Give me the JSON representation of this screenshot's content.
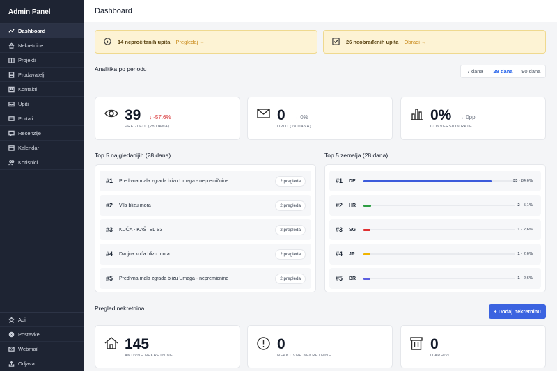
{
  "app": {
    "title": "Admin Panel"
  },
  "sidebar": {
    "items": [
      {
        "label": "Dashboard",
        "icon": "trend-icon",
        "active": true
      },
      {
        "label": "Nekretnine",
        "icon": "home-icon"
      },
      {
        "label": "Projekti",
        "icon": "building-icon"
      },
      {
        "label": "Prodavatelji",
        "icon": "users-icon"
      },
      {
        "label": "Kontakti",
        "icon": "contact-icon"
      },
      {
        "label": "Upiti",
        "icon": "inbox-icon"
      },
      {
        "label": "Portali",
        "icon": "globe-icon"
      },
      {
        "label": "Recenzije",
        "icon": "review-icon"
      },
      {
        "label": "Kalendar",
        "icon": "calendar-icon"
      },
      {
        "label": "Korisnici",
        "icon": "user-group-icon"
      }
    ],
    "bottom": [
      {
        "label": "Adi",
        "icon": "star-icon"
      },
      {
        "label": "Postavke",
        "icon": "gear-icon"
      },
      {
        "label": "Webmail",
        "icon": "mail-icon"
      },
      {
        "label": "Odjava",
        "icon": "logout-icon"
      }
    ]
  },
  "header": {
    "title": "Dashboard"
  },
  "alerts": {
    "unread": {
      "text": "14 nepročitanih upita",
      "action": "Pregledaj →"
    },
    "unprocessed": {
      "text": "26 neobrađenih upita",
      "action": "Obradi →"
    }
  },
  "analytics": {
    "title": "Analitika po periodu",
    "ranges": [
      "7 dana",
      "28 dana",
      "90 dana"
    ],
    "selected_range": "28 dana",
    "stats": [
      {
        "value": "39",
        "delta": "↓ -57.6%",
        "label": "PREGLEDI (28 DANA)",
        "icon": "eye-icon",
        "delta_color": "#d9383a"
      },
      {
        "value": "0",
        "delta": "→ 0%",
        "label": "UPITI (28 DANA)",
        "icon": "envelope-icon",
        "delta_color": "#6b7280"
      },
      {
        "value": "0%",
        "delta": "→ 0pp",
        "label": "CONVERSION RATE",
        "icon": "bar-chart-icon",
        "delta_color": "#6b7280"
      }
    ]
  },
  "top_viewed": {
    "title": "Top 5 najgledanijih (28 dana)",
    "rows": [
      {
        "rank": "#1",
        "name": "Predivna mala zgrada blizu Umaga - nepremičnine",
        "views": "2 pregleda"
      },
      {
        "rank": "#2",
        "name": "Vila blizu mora",
        "views": "2 pregleda"
      },
      {
        "rank": "#3",
        "name": "KUĆA - KAŠTEL S3",
        "views": "2 pregleda"
      },
      {
        "rank": "#4",
        "name": "Dvojna kuća blizu mora",
        "views": "2 pregleda"
      },
      {
        "rank": "#5",
        "name": "Predivna mala zgrada blizu Umaga - nepremicnine",
        "views": "2 pregleda"
      }
    ]
  },
  "top_countries": {
    "title": "Top 5 zemalja (28 dana)",
    "rows": [
      {
        "rank": "#1",
        "code": "DE",
        "count": "33",
        "share": "84,6%",
        "fraction": 0.846,
        "color": "#3b5bdb"
      },
      {
        "rank": "#2",
        "code": "HR",
        "count": "2",
        "share": "5,1%",
        "fraction": 0.051,
        "color": "#2f9e44"
      },
      {
        "rank": "#3",
        "code": "SG",
        "count": "1",
        "share": "2,6%",
        "fraction": 0.026,
        "color": "#e03131"
      },
      {
        "rank": "#4",
        "code": "JP",
        "count": "1",
        "share": "2,6%",
        "fraction": 0.026,
        "color": "#f0b400"
      },
      {
        "rank": "#5",
        "code": "BR",
        "count": "1",
        "share": "2,6%",
        "fraction": 0.026,
        "color": "#5c5fe0"
      }
    ]
  },
  "properties": {
    "title": "Pregled nekretnina",
    "add_label": "+ Dodaj nekretninu",
    "stats": [
      {
        "value": "145",
        "label": "AKTIVNE NEKRETNINE",
        "icon": "house-outline-icon"
      },
      {
        "value": "0",
        "label": "NEAKTIVNE NEKRETNINE",
        "icon": "alert-circle-icon"
      },
      {
        "value": "0",
        "label": "U ARHIVI",
        "icon": "archive-icon"
      }
    ]
  }
}
